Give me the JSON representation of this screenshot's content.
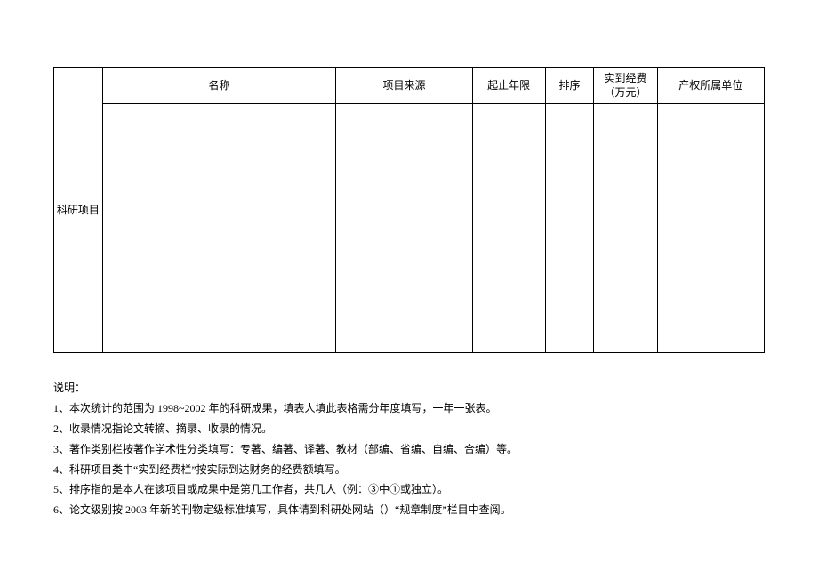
{
  "table": {
    "row_label": "科研项目",
    "headers": {
      "name": "名称",
      "source": "项目来源",
      "years": "起止年限",
      "order": "排序",
      "fund": "实到经费（万元）",
      "owner": "产权所属单位"
    },
    "cells": {
      "name": "",
      "source": "",
      "years": "",
      "order": "",
      "fund": "",
      "owner": ""
    }
  },
  "notes": {
    "title": "说明：",
    "items": [
      "1、本次统计的范围为 1998~2002 年的科研成果，填表人填此表格需分年度填写，一年一张表。",
      "2、收录情况指论文转摘、摘录、收录的情况。",
      "3、著作类别栏按著作学术性分类填写：专著、编著、译著、教材（部编、省编、自编、合编）等。",
      "4、科研项目类中“实到经费栏”按实际到达财务的经费额填写。",
      "5、排序指的是本人在该项目或成果中是第几工作者，共几人（例：③中①或独立）。",
      "6、论文级别按 2003 年新的刊物定级标准填写，具体请到科研处网站（）“规章制度”栏目中查阅。"
    ]
  }
}
